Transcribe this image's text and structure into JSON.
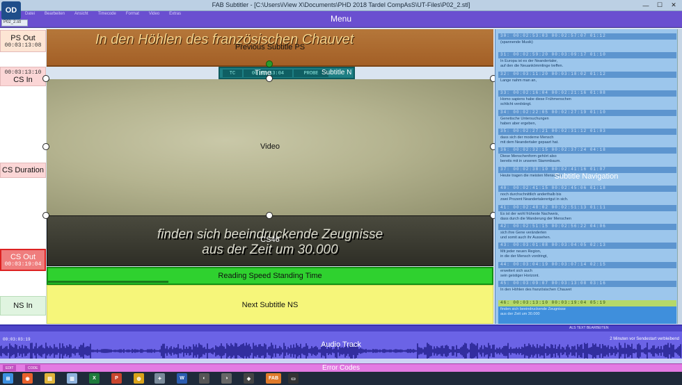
{
  "window": {
    "title": "FAB Subtitler - [C:\\Users\\iView X\\Documents\\PHD 2018 Tardel CompAsS\\UT-Files\\P02_2.stl]",
    "logo": "OD",
    "file_tab": "P02_2.stl"
  },
  "menu": {
    "label": "Menu",
    "items": [
      "Datei",
      "Bearbeiten",
      "Ansicht",
      "Timecode",
      "Format",
      "Video",
      "Extras"
    ]
  },
  "left_labels": {
    "ps_out": {
      "label": "PS Out",
      "time": "00:03:13:08"
    },
    "cs_in": {
      "label": "CS In",
      "time": "00:03:13:10"
    },
    "cs_duration": {
      "label": "CS Duration"
    },
    "cs_out": {
      "label": "CS Out",
      "time": "00:03:19:04"
    },
    "ns_in": {
      "label": "NS In"
    }
  },
  "previous_subtitle": {
    "text": "In den Höhlen des französischen Chauvet",
    "label": "Previous Subtitle PS"
  },
  "time_bar": {
    "tc": "TC",
    "time": "00:03:13:04",
    "label": "Time",
    "probe": "PROBE",
    "subtitle_n": "Subtitle N"
  },
  "video": {
    "label": "Video"
  },
  "current_subtitle": {
    "line1": "finden sich beeindruckende Zeugnisse",
    "line2": "aus der Zeit um 30.000",
    "id": "CS46"
  },
  "reading_speed": {
    "label": "Reading Speed Standing Time",
    "fill_fraction": 0.27
  },
  "next_subtitle": {
    "label": "Next Subtitle NS"
  },
  "subtitle_navigation": {
    "label": "Subtitle Navigation",
    "entries": [
      {
        "hdr": "30:    00:02:53:03    00:02:57:07    01:12",
        "lines": [
          "(spannende Musik)",
          ""
        ]
      },
      {
        "hdr": "31:    00:02:59:20    00:03:09:17    01:10",
        "lines": [
          "In Europa ist es der Neandertaler,",
          "auf den die Neuankömmlinge treffen."
        ]
      },
      {
        "hdr": "32:    00:03:11:20    00:03:18:02    01:12",
        "lines": [
          "Lange nahm man an,",
          ""
        ]
      },
      {
        "hdr": "33:    00:02:16:04    00:02:21:16    01:08",
        "lines": [
          "Homo sapiens habe diese Frühmenschen",
          "schlicht verdrängt."
        ]
      },
      {
        "hdr": "34:    00:02:22:05    00:02:27:19    01:10",
        "lines": [
          "Genetische Untersuchungen",
          "haben aber ergeben,"
        ]
      },
      {
        "hdr": "35:    00:02:27:21    00:02:31:12    01:03",
        "lines": [
          "dass sich der moderne Mensch",
          "mit dem Neandertaler gepaart hat."
        ]
      },
      {
        "hdr": "36:    00:02:32:15    00:02:37:24    04:18",
        "lines": [
          "Diese Menschenform gehört also",
          "bereits mit in unseren Stammbaum."
        ]
      },
      {
        "hdr": "37:    00:02:38:10    00:02:41:16    01:07",
        "lines": [
          "Heute tragen die meisten Menschen",
          ""
        ]
      },
      {
        "hdr": "40:    00:02:41:15    00:02:45:06    01:18",
        "lines": [
          "noch durchschnittlich anderthalb bis",
          "zwei Prozent Neandertalerertgut in sich."
        ]
      },
      {
        "hdr": "41:    00:02:48:02    00:02:51:13    01:11",
        "lines": [
          "Es ist der wohl früheste Nachweis,",
          "dass durch die Wanderung der Menschen"
        ]
      },
      {
        "hdr": "42:    00:02:51:15    00:02:56:22    04:06",
        "lines": [
          "sich ihre Gene veränderten",
          "und somit auch ihr Aussehen."
        ]
      },
      {
        "hdr": "43:    00:03:01:08    00:03:04:05    02:13",
        "lines": [
          "Mit jeder neuen Region,",
          "in die der Mensch vordringt,"
        ]
      },
      {
        "hdr": "44:    00:03:04:19    00:03:07:14    02:15",
        "lines": [
          "erweitert sich auch",
          "sein geistiger Horizont."
        ]
      },
      {
        "hdr": "45:    00:03:09:07    00:03:13:08    03:16",
        "lines": [
          "In den Höhlen des französischen Chauvet",
          ""
        ]
      },
      {
        "hdr": "46:    00:03:13:10    00:03:19:04    05:19",
        "lines": [
          "finden sich beeindruckende Zeugnisse",
          "aus der Zeit um 30.000"
        ]
      }
    ]
  },
  "audio": {
    "label": "Audio Track",
    "header_action": "ALS TEXT BEARBEITEN",
    "timecode": "00:03:03:19",
    "right_text": "2 Minuten vor Sendestart verbleibend"
  },
  "errors": {
    "label": "Error Codes",
    "btn1": "EDIT",
    "btn2": "CODE"
  },
  "taskbar": {
    "icons": [
      "windows-icon",
      "firefox-icon",
      "explorer-icon",
      "notepad-icon",
      "excel-icon",
      "powerpoint-icon",
      "headset-icon",
      "tools-icon",
      "word-icon",
      "eye-icon",
      "eye2-icon",
      "camera-icon",
      "fab-icon",
      "terminal-icon"
    ],
    "fab_label": "FAB"
  },
  "colors": {
    "menu": "#6a4fd0",
    "previous": "#a35f26",
    "reading": "#2fd12f",
    "next": "#f6f67a",
    "nav": "#9cc6ec",
    "audio": "#6b63e6",
    "errors": "#e37ae3"
  }
}
